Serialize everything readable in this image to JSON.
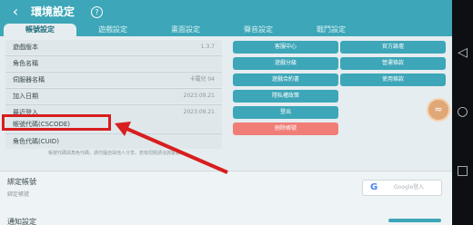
{
  "header": {
    "title": "環境設定",
    "help_icon": "?",
    "back_icon": "back-arrow-icon"
  },
  "tabs": [
    {
      "label": "帳號設定",
      "active": true
    },
    {
      "label": "遊戲設定",
      "active": false
    },
    {
      "label": "畫面設定",
      "active": false
    },
    {
      "label": "聲音設定",
      "active": false
    },
    {
      "label": "戰鬥設定",
      "active": false
    }
  ],
  "info_rows": [
    {
      "label": "遊戲版本",
      "value": "1.3.7"
    },
    {
      "label": "角色名稱",
      "value": ""
    },
    {
      "label": "伺服器名稱",
      "value": "卡羅兒 04"
    },
    {
      "label": "加入日期",
      "value": "2023.09.21"
    },
    {
      "label": "最近登入",
      "value": "2023.09.21"
    },
    {
      "label": "帳號代碼(CSCODE)",
      "value": ""
    },
    {
      "label": "角色代碼(CUID)",
      "value": ""
    }
  ],
  "note": "帳號代碼與角色代碼，請勿擅自與他人分享。若有問題請洽詢客服。",
  "buttons": [
    {
      "label": "客服中心"
    },
    {
      "label": "官方論壇"
    },
    {
      "label": "遊戲分級"
    },
    {
      "label": "營運條款"
    },
    {
      "label": "遊戲合約書"
    },
    {
      "label": "使用條款"
    },
    {
      "label": "隱私權政策"
    },
    {
      "label": "登出"
    },
    {
      "label": "刪除帳號"
    }
  ],
  "bind": {
    "title": "綁定帳號",
    "subtitle": "綁定帳號",
    "google_label": "Google登入",
    "next_title": "通知設定"
  },
  "colors": {
    "accent": "#3da6b8",
    "danger": "#f07e77",
    "highlight": "#d81e1e"
  }
}
